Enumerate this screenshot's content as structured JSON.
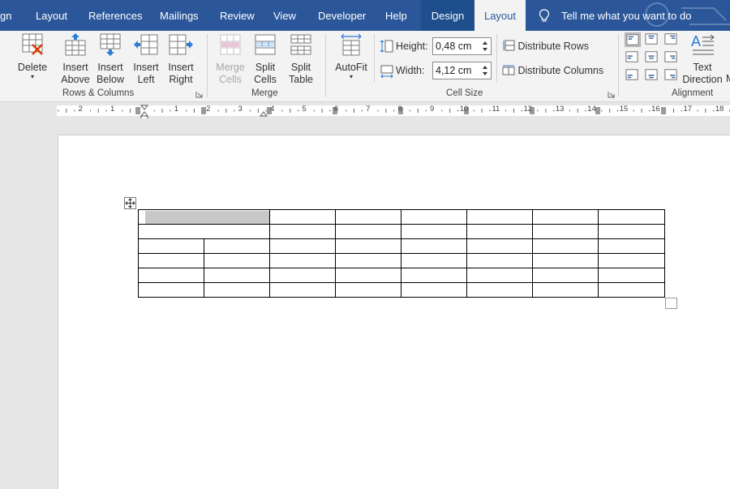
{
  "tabs": [
    {
      "label": "gn",
      "active": false
    },
    {
      "label": "Layout",
      "active": false
    },
    {
      "label": "References",
      "active": false
    },
    {
      "label": "Mailings",
      "active": false
    },
    {
      "label": "Review",
      "active": false
    },
    {
      "label": "View",
      "active": false
    },
    {
      "label": "Developer",
      "active": false
    },
    {
      "label": "Help",
      "active": false
    },
    {
      "label": "Design",
      "active": false
    },
    {
      "label": "Layout",
      "active": true
    }
  ],
  "tell_me": "Tell me what you want to do",
  "colors": {
    "accent": "#2b579a",
    "ribbon_bg": "#f3f3f3",
    "selected_cell": "#c8c8c8"
  },
  "rows_columns": {
    "delete": "Delete",
    "insert_above": [
      "Insert",
      "Above"
    ],
    "insert_below": [
      "Insert",
      "Below"
    ],
    "insert_left": [
      "Insert",
      "Left"
    ],
    "insert_right": [
      "Insert",
      "Right"
    ],
    "group_label": "Rows & Columns"
  },
  "merge": {
    "merge_cells": [
      "Merge",
      "Cells"
    ],
    "split_cells": [
      "Split",
      "Cells"
    ],
    "split_table": [
      "Split",
      "Table"
    ],
    "group_label": "Merge"
  },
  "cell_size": {
    "autofit": "AutoFit",
    "height_label": "Height:",
    "height_value": "0,48 cm",
    "width_label": "Width:",
    "width_value": "4,12 cm",
    "distribute_rows": "Distribute Rows",
    "distribute_columns": "Distribute Columns",
    "group_label": "Cell Size"
  },
  "alignment": {
    "text_direction": [
      "Text",
      "Direction"
    ],
    "group_label": "Alignment",
    "overflow_letter": "M"
  },
  "ruler": {
    "numbers_left": [
      "2",
      "1"
    ],
    "numbers_right": [
      "1",
      "2",
      "3",
      "4",
      "5",
      "6",
      "7",
      "8",
      "9",
      "10",
      "11",
      "12",
      "13",
      "14",
      "15",
      "16",
      "17",
      "18"
    ]
  },
  "table": {
    "rows": 6,
    "columns": 8,
    "merged_top_left": true,
    "selected_cell": "row1-col1"
  }
}
